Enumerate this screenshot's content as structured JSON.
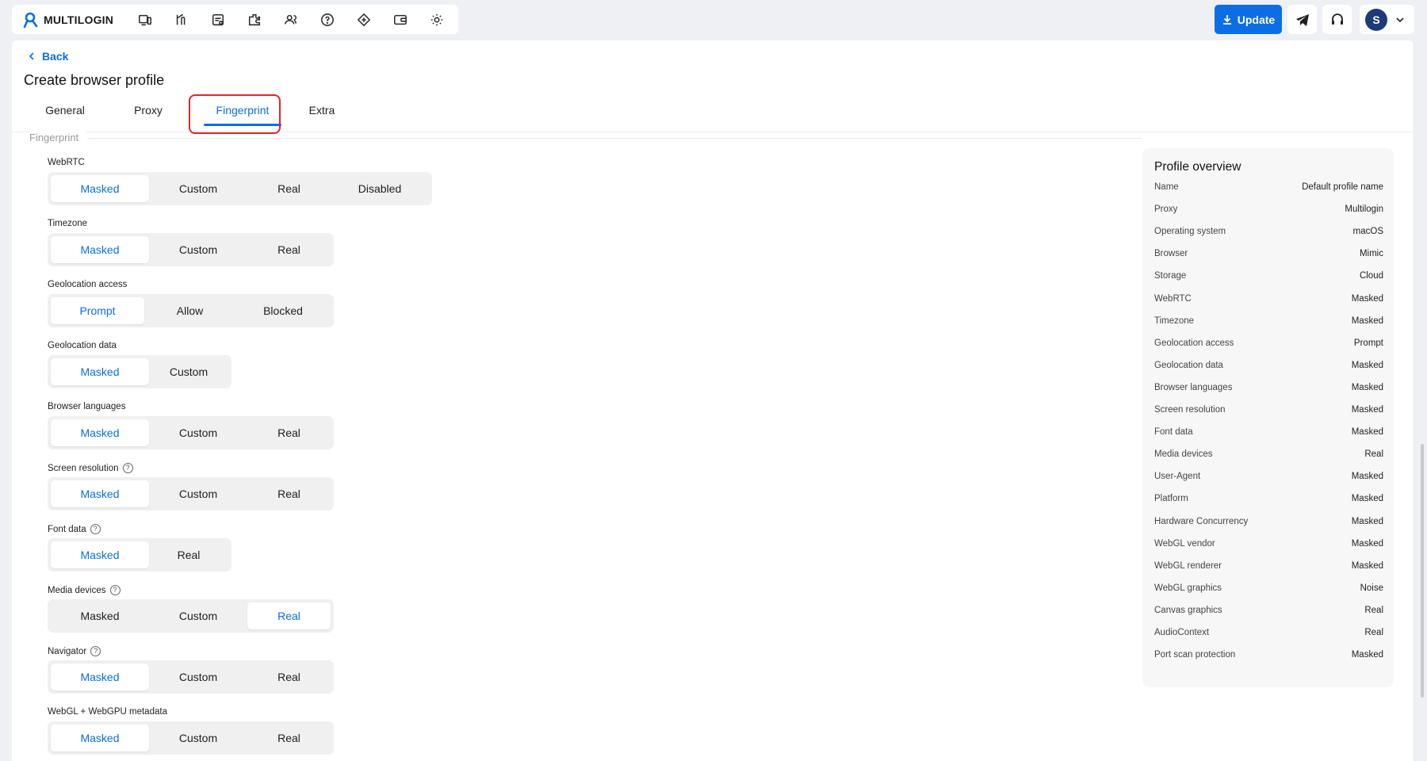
{
  "topbar": {
    "logo_text": "MULTILOGIN",
    "nav_icons": [
      "profiles-icon",
      "automation-icon",
      "team-icon",
      "extensions-icon",
      "users-icon",
      "help-icon",
      "api-icon",
      "wallet-icon",
      "settings-icon"
    ],
    "update_label": "Update",
    "avatar_initial": "S"
  },
  "colors": {
    "accent": "#0b6ee5",
    "highlight": "#e0262b",
    "avatar": "#1d3a7a"
  },
  "page": {
    "back_label": "Back",
    "title": "Create browser profile",
    "tabs": [
      {
        "label": "General",
        "active": false
      },
      {
        "label": "Proxy",
        "active": false
      },
      {
        "label": "Fingerprint",
        "active": true
      },
      {
        "label": "Extra",
        "active": false
      }
    ],
    "section_label": "Fingerprint"
  },
  "fields": [
    {
      "label": "WebRTC",
      "help": false,
      "options": [
        "Masked",
        "Custom",
        "Real",
        "Disabled"
      ],
      "selected": "Masked"
    },
    {
      "label": "Timezone",
      "help": false,
      "options": [
        "Masked",
        "Custom",
        "Real"
      ],
      "selected": "Masked"
    },
    {
      "label": "Geolocation access",
      "help": false,
      "options": [
        "Prompt",
        "Allow",
        "Blocked"
      ],
      "selected": "Prompt"
    },
    {
      "label": "Geolocation data",
      "help": false,
      "options": [
        "Masked",
        "Custom"
      ],
      "selected": "Masked"
    },
    {
      "label": "Browser languages",
      "help": false,
      "options": [
        "Masked",
        "Custom",
        "Real"
      ],
      "selected": "Masked"
    },
    {
      "label": "Screen resolution",
      "help": true,
      "options": [
        "Masked",
        "Custom",
        "Real"
      ],
      "selected": "Masked"
    },
    {
      "label": "Font data",
      "help": true,
      "options": [
        "Masked",
        "Real"
      ],
      "selected": "Masked"
    },
    {
      "label": "Media devices",
      "help": true,
      "options": [
        "Masked",
        "Custom",
        "Real"
      ],
      "selected": "Real"
    },
    {
      "label": "Navigator",
      "help": true,
      "options": [
        "Masked",
        "Custom",
        "Real"
      ],
      "selected": "Masked"
    },
    {
      "label": "WebGL + WebGPU metadata",
      "help": false,
      "options": [
        "Masked",
        "Custom",
        "Real"
      ],
      "selected": "Masked"
    }
  ],
  "overview": {
    "title": "Profile overview",
    "rows": [
      {
        "label": "Name",
        "value": "Default profile name"
      },
      {
        "label": "Proxy",
        "value": "Multilogin"
      },
      {
        "label": "Operating system",
        "value": "macOS"
      },
      {
        "label": "Browser",
        "value": "Mimic"
      },
      {
        "label": "Storage",
        "value": "Cloud"
      },
      {
        "label": "WebRTC",
        "value": "Masked"
      },
      {
        "label": "Timezone",
        "value": "Masked"
      },
      {
        "label": "Geolocation access",
        "value": "Prompt"
      },
      {
        "label": "Geolocation data",
        "value": "Masked"
      },
      {
        "label": "Browser languages",
        "value": "Masked"
      },
      {
        "label": "Screen resolution",
        "value": "Masked"
      },
      {
        "label": "Font data",
        "value": "Masked"
      },
      {
        "label": "Media devices",
        "value": "Real"
      },
      {
        "label": "User-Agent",
        "value": "Masked"
      },
      {
        "label": "Platform",
        "value": "Masked"
      },
      {
        "label": "Hardware Concurrency",
        "value": "Masked"
      },
      {
        "label": "WebGL vendor",
        "value": "Masked"
      },
      {
        "label": "WebGL renderer",
        "value": "Masked"
      },
      {
        "label": "WebGL graphics",
        "value": "Noise"
      },
      {
        "label": "Canvas graphics",
        "value": "Real"
      },
      {
        "label": "AudioContext",
        "value": "Real"
      },
      {
        "label": "Port scan protection",
        "value": "Masked"
      }
    ]
  }
}
